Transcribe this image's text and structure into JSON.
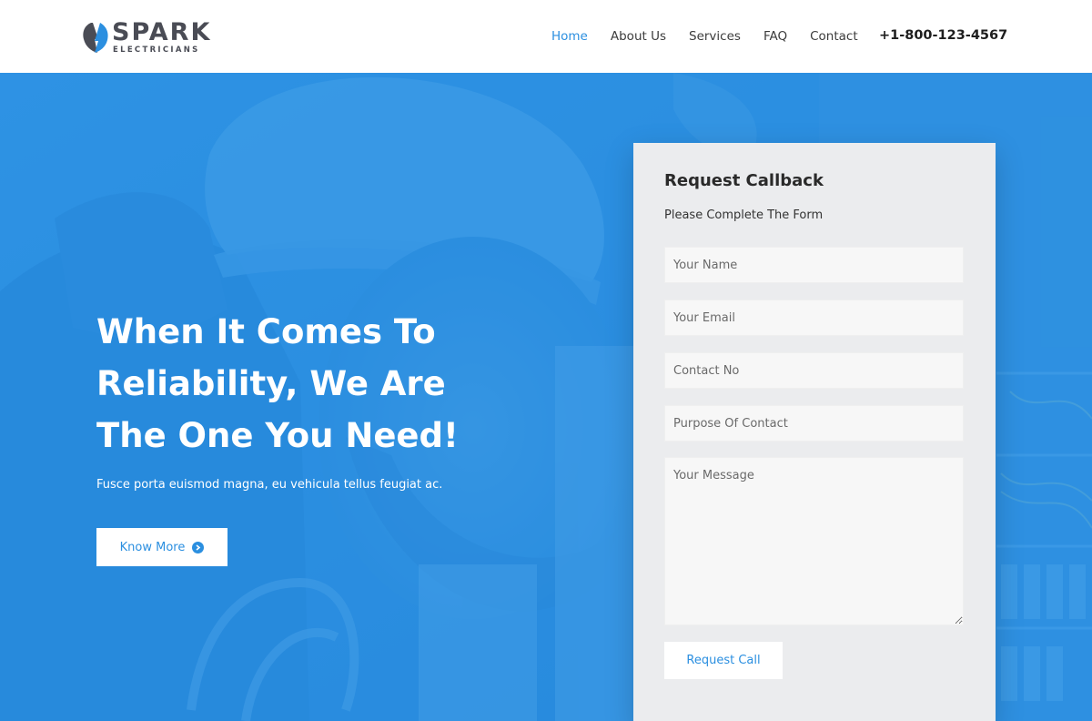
{
  "header": {
    "logo": {
      "name": "SPARK",
      "tagline": "ELECTRICIANS"
    },
    "nav": [
      {
        "label": "Home",
        "active": true
      },
      {
        "label": "About Us",
        "active": false
      },
      {
        "label": "Services",
        "active": false
      },
      {
        "label": "FAQ",
        "active": false
      },
      {
        "label": "Contact",
        "active": false
      }
    ],
    "phone": "+1-800-123-4567"
  },
  "hero": {
    "title_lines": [
      "When It Comes To",
      "Reliability, We Are",
      "The One You Need!"
    ],
    "subtitle": "Fusce porta euismod magna, eu vehicula tellus feugiat ac.",
    "button_label": "Know More"
  },
  "form": {
    "title": "Request Callback",
    "subtitle": "Please Complete The Form",
    "fields": {
      "name": {
        "placeholder": "Your Name",
        "value": ""
      },
      "email": {
        "placeholder": "Your Email",
        "value": ""
      },
      "contact": {
        "placeholder": "Contact No",
        "value": ""
      },
      "purpose": {
        "placeholder": "Purpose Of Contact",
        "value": ""
      },
      "message": {
        "placeholder": "Your Message",
        "value": ""
      }
    },
    "submit_label": "Request Call"
  },
  "colors": {
    "accent": "#2b8fe0",
    "hero_overlay": "#248ce1",
    "card_bg": "#ebecee",
    "text_dark": "#2a2a2a"
  }
}
